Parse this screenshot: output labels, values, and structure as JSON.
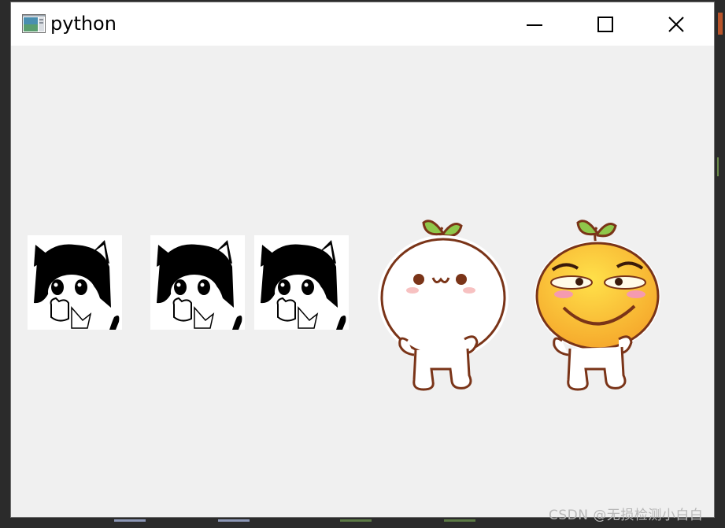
{
  "window": {
    "title": "python",
    "icon": "app-window-icon",
    "controls": [
      "minimize-icon",
      "maximize-icon",
      "close-icon"
    ]
  },
  "content": {
    "images": [
      {
        "kind": "anime-cat-girl-image"
      },
      {
        "kind": "anime-cat-girl-image"
      },
      {
        "kind": "anime-cat-girl-image"
      },
      {
        "kind": "white-bun-sticker-image"
      },
      {
        "kind": "orange-bun-sticker-image"
      }
    ]
  },
  "watermark": {
    "text": "CSDN @无损检测小白白"
  },
  "colors": {
    "window_bg": "#f0f0f0",
    "titlebar_bg": "#ffffff",
    "desktop_bg": "#2b2b2b"
  }
}
